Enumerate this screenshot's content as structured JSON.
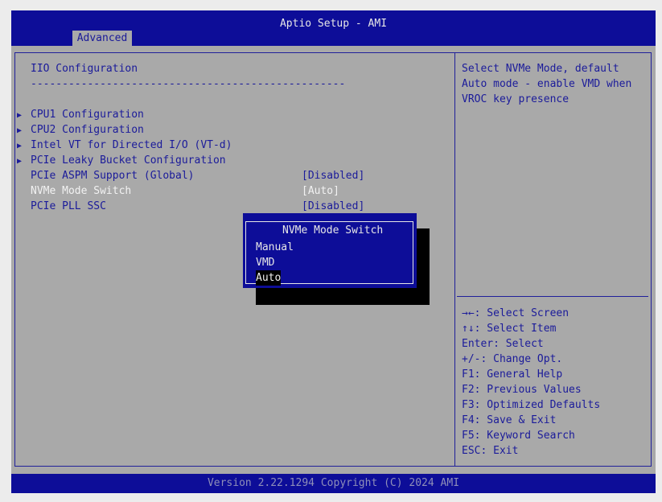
{
  "header": {
    "title": "Aptio Setup - AMI",
    "active_tab": "Advanced"
  },
  "main": {
    "heading": "IIO Configuration",
    "separator": "--------------------------------------------------",
    "submenus": [
      "CPU1 Configuration",
      "CPU2 Configuration",
      "Intel VT for Directed I/O (VT-d)",
      "PCIe Leaky Bucket Configuration"
    ],
    "settings": [
      {
        "label": "PCIe ASPM Support (Global)",
        "value": "[Disabled]"
      },
      {
        "label": "NVMe Mode Switch",
        "value": "[Auto]"
      },
      {
        "label": "PCIe PLL SSC",
        "value": "[Disabled]"
      }
    ]
  },
  "help": {
    "description": [
      "Select NVMe Mode, default",
      "Auto mode - enable VMD when",
      "VROC key presence"
    ],
    "keys": [
      "→←: Select Screen",
      "↑↓: Select Item",
      "Enter: Select",
      "+/-: Change Opt.",
      "F1: General Help",
      "F2: Previous Values",
      "F3: Optimized Defaults",
      "F4: Save & Exit",
      "F5: Keyword Search",
      "ESC: Exit"
    ]
  },
  "popup": {
    "title": "NVMe Mode Switch",
    "options": [
      "Manual",
      "VMD",
      "Auto"
    ],
    "selected": "Auto"
  },
  "footer": {
    "version": "Version 2.22.1294 Copyright (C) 2024 AMI"
  }
}
